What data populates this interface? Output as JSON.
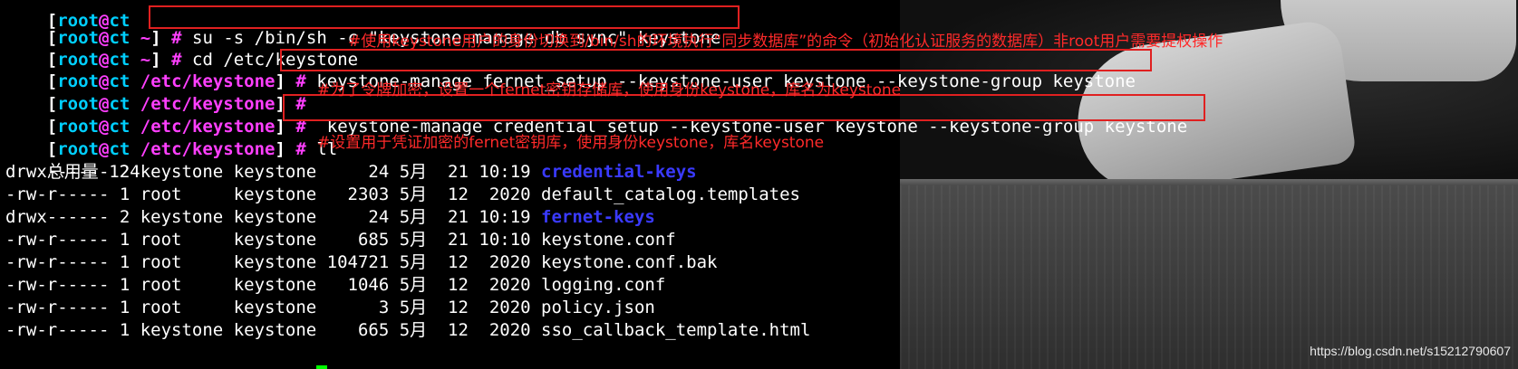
{
  "prompt": {
    "lbracket": "[",
    "user": "root",
    "at": "@",
    "host": "ct",
    "rbracket": "]",
    "hash": "#",
    "home_path": "~",
    "etc_path": "/etc/keystone"
  },
  "commands": {
    "c1": "su -s /bin/sh -c \"keystone-manage db sync\" keystone",
    "c2": "cd /etc/keystone",
    "c3": "keystone-manage fernet_setup --keystone-user keystone --keystone-group keystone",
    "c5": "keystone-manage credential_setup --keystone-user keystone --keystone-group keystone",
    "c6": "ll"
  },
  "annotations": {
    "a1": "#使用keystone用户的身份切换到/bin/sh的环境执行“同步数据库”的命令（初始化认证服务的数据库）非root用户需要提权操作",
    "a2": "#为了令牌加密，设置一个fernet密钥存储库，使用身份keystone，库名为keystone",
    "a3": "#设置用于凭证加密的fernet密钥库，使用身份keystone，库名keystone"
  },
  "listing": {
    "total": "总用量 124",
    "rows": [
      {
        "perm": "drwx------",
        "links": "2",
        "owner": "keystone",
        "group": "keystone",
        "size": "24",
        "month": "5月",
        "day": "21",
        "time": "10:19",
        "name": "credential-keys",
        "is_dir": true
      },
      {
        "perm": "-rw-r-----",
        "links": "1",
        "owner": "root",
        "group": "keystone",
        "size": "2303",
        "month": "5月",
        "day": "12",
        "time": "2020",
        "name": "default_catalog.templates",
        "is_dir": false
      },
      {
        "perm": "drwx------",
        "links": "2",
        "owner": "keystone",
        "group": "keystone",
        "size": "24",
        "month": "5月",
        "day": "21",
        "time": "10:19",
        "name": "fernet-keys",
        "is_dir": true
      },
      {
        "perm": "-rw-r-----",
        "links": "1",
        "owner": "root",
        "group": "keystone",
        "size": "685",
        "month": "5月",
        "day": "21",
        "time": "10:10",
        "name": "keystone.conf",
        "is_dir": false
      },
      {
        "perm": "-rw-r-----",
        "links": "1",
        "owner": "root",
        "group": "keystone",
        "size": "104721",
        "month": "5月",
        "day": "12",
        "time": "2020",
        "name": "keystone.conf.bak",
        "is_dir": false
      },
      {
        "perm": "-rw-r-----",
        "links": "1",
        "owner": "root",
        "group": "keystone",
        "size": "1046",
        "month": "5月",
        "day": "12",
        "time": "2020",
        "name": "logging.conf",
        "is_dir": false
      },
      {
        "perm": "-rw-r-----",
        "links": "1",
        "owner": "root",
        "group": "keystone",
        "size": "3",
        "month": "5月",
        "day": "12",
        "time": "2020",
        "name": "policy.json",
        "is_dir": false
      },
      {
        "perm": "-rw-r-----",
        "links": "1",
        "owner": "keystone",
        "group": "keystone",
        "size": "665",
        "month": "5月",
        "day": "12",
        "time": "2020",
        "name": "sso_callback_template.html",
        "is_dir": false
      }
    ]
  },
  "watermark": "https://blog.csdn.net/s15212790607",
  "colors": {
    "background": "#000000",
    "prompt_user": "#00cfff",
    "prompt_path": "#ff3fff",
    "directory": "#3a3aff",
    "annotation": "#ff2a2a",
    "cursor": "#00ff00"
  }
}
